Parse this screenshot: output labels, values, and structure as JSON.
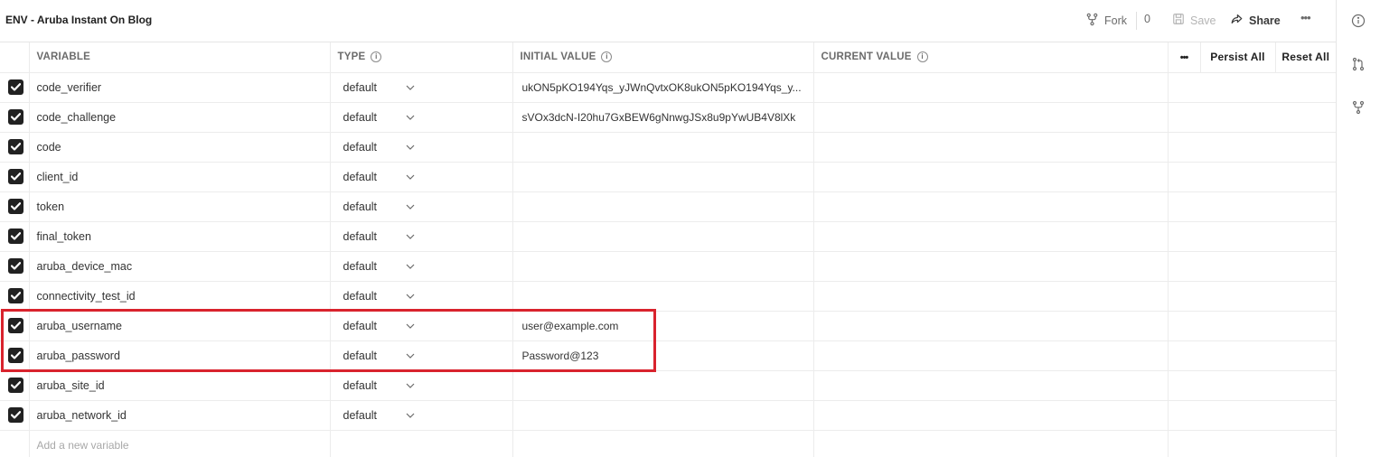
{
  "header": {
    "title": "ENV - Aruba Instant On Blog",
    "fork_label": "Fork",
    "fork_count": "0",
    "save_label": "Save",
    "share_label": "Share"
  },
  "columns": {
    "variable": "VARIABLE",
    "type": "TYPE",
    "initial_value": "INITIAL VALUE",
    "current_value": "CURRENT VALUE",
    "persist_all": "Persist All",
    "reset_all": "Reset All"
  },
  "rows": [
    {
      "name": "code_verifier",
      "type": "default",
      "initial": "ukON5pKO194Yqs_yJWnQvtxOK8ukON5pKO194Yqs_y...",
      "current": ""
    },
    {
      "name": "code_challenge",
      "type": "default",
      "initial": "sVOx3dcN-I20hu7GxBEW6gNnwgJSx8u9pYwUB4V8lXk",
      "current": ""
    },
    {
      "name": "code",
      "type": "default",
      "initial": "",
      "current": ""
    },
    {
      "name": "client_id",
      "type": "default",
      "initial": "",
      "current": ""
    },
    {
      "name": "token",
      "type": "default",
      "initial": "",
      "current": ""
    },
    {
      "name": "final_token",
      "type": "default",
      "initial": "",
      "current": ""
    },
    {
      "name": "aruba_device_mac",
      "type": "default",
      "initial": "",
      "current": ""
    },
    {
      "name": "connectivity_test_id",
      "type": "default",
      "initial": "",
      "current": ""
    },
    {
      "name": "aruba_username",
      "type": "default",
      "initial": "user@example.com",
      "current": ""
    },
    {
      "name": "aruba_password",
      "type": "default",
      "initial": "Password@123",
      "current": ""
    },
    {
      "name": "aruba_site_id",
      "type": "default",
      "initial": "",
      "current": ""
    },
    {
      "name": "aruba_network_id",
      "type": "default",
      "initial": "",
      "current": ""
    }
  ],
  "add_placeholder": "Add a new variable",
  "colors": {
    "highlight": "#d9232d",
    "checkbox": "#212121"
  },
  "icons": {
    "fork": "fork-icon",
    "save": "save-icon",
    "share": "share-icon",
    "more": "more-icon",
    "info": "info-icon",
    "pull_request": "pull-request-icon",
    "branch": "branch-icon"
  }
}
